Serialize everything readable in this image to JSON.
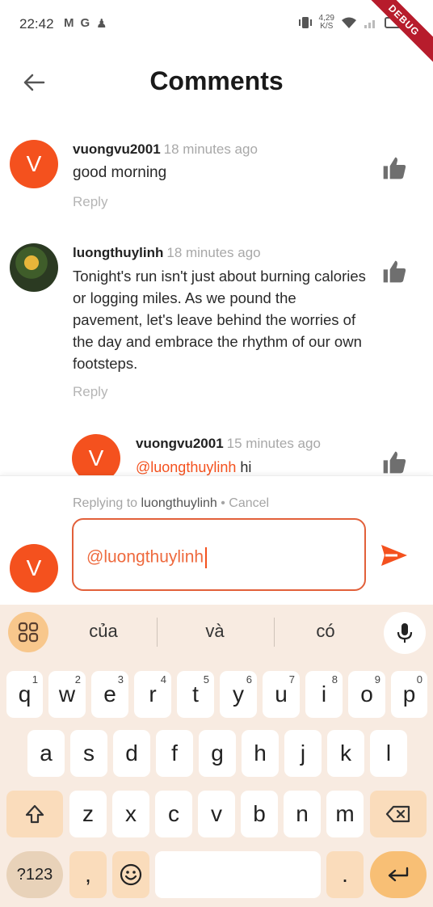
{
  "status": {
    "time": "22:42",
    "left_icons": [
      "M",
      "G",
      "♟"
    ],
    "net_speed_value": "4,29",
    "net_speed_unit": "K/S",
    "debug_label": "DEBUG"
  },
  "header": {
    "title": "Comments"
  },
  "comments": [
    {
      "user": "vuongvu2001",
      "time": "18 minutes ago",
      "text": "good morning",
      "reply": "Reply",
      "avatar_letter": "V"
    },
    {
      "user": "luongthuylinh",
      "time": "18 minutes ago",
      "text": "Tonight's run isn't just about burning calories or logging miles. As we pound the pavement, let's leave behind the worries of the day and embrace the rhythm of our own footsteps.",
      "reply": "Reply"
    },
    {
      "user": "vuongvu2001",
      "time": "15 minutes ago",
      "mention": "@luongthuylinh",
      "text": " hi",
      "avatar_letter": "V"
    }
  ],
  "reply_bar": {
    "replying_prefix": "Replying to",
    "replying_to": "luongthuylinh",
    "cancel": "• Cancel",
    "input_value": "@luongthuylinh",
    "avatar_letter": "V"
  },
  "keyboard": {
    "suggestions": [
      "của",
      "và",
      "có"
    ],
    "row1": [
      "q",
      "w",
      "e",
      "r",
      "t",
      "y",
      "u",
      "i",
      "o",
      "p"
    ],
    "row1_hints": [
      "1",
      "2",
      "3",
      "4",
      "5",
      "6",
      "7",
      "8",
      "9",
      "0"
    ],
    "row2": [
      "a",
      "s",
      "d",
      "f",
      "g",
      "h",
      "j",
      "k",
      "l"
    ],
    "row3": [
      "z",
      "x",
      "c",
      "v",
      "b",
      "n",
      "m"
    ],
    "symbols": "?123",
    "comma": ",",
    "period": "."
  },
  "colors": {
    "accent": "#f4511e",
    "keyboard_bg": "#f8ebe1"
  }
}
